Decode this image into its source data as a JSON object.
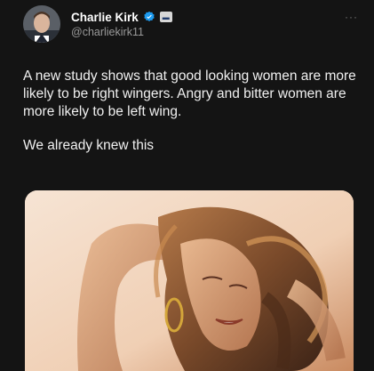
{
  "author": {
    "display_name": "Charlie Kirk",
    "handle": "@charliekirk11",
    "verified_icon": "verified-badge-icon",
    "affiliate_icon": "affiliate-badge-icon"
  },
  "post": {
    "paragraphs": [
      "A new study shows that good looking women are more likely to be right wingers. Angry and bitter women are more likely to be left wing.",
      "We already knew this"
    ],
    "more_label": "···"
  },
  "media": {
    "type": "photo",
    "subject": "woman-with-flowing-hair-photo"
  },
  "colors": {
    "background": "#141414",
    "text": "#f0f0f0",
    "handle": "#9a9a9a",
    "verified": "#1d9bf0"
  }
}
